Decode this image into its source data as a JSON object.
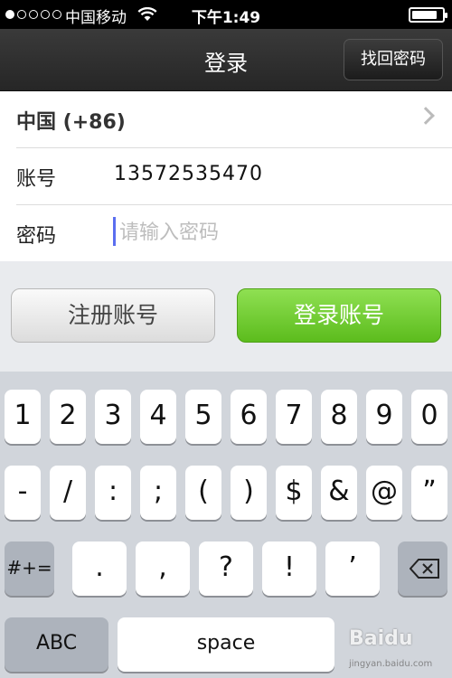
{
  "status_bar": {
    "carrier": "中国移动",
    "time": "下午1:49",
    "signal_bars": 1,
    "signal_total": 5,
    "battery_level": 0.85
  },
  "nav": {
    "title": "登录",
    "find_password": "找回密码"
  },
  "form": {
    "country": "中国 (+86)",
    "account_label": "账号",
    "account_value": "13572535470",
    "password_label": "密码",
    "password_placeholder": "请输入密码"
  },
  "actions": {
    "register": "注册账号",
    "login": "登录账号"
  },
  "keyboard": {
    "row1": [
      "1",
      "2",
      "3",
      "4",
      "5",
      "6",
      "7",
      "8",
      "9",
      "0"
    ],
    "row2": [
      "-",
      "/",
      ":",
      ";",
      "(",
      ")",
      "$",
      "&",
      "@",
      "”"
    ],
    "row3_left": "#+=",
    "row3": [
      ".",
      ",",
      "?",
      "!",
      "’"
    ],
    "row3_icon": "backspace-icon",
    "abc": "ABC",
    "space": "space"
  },
  "watermark": {
    "brand": "Baidu",
    "site": "jingyan.baidu.com"
  },
  "colors": {
    "login_green": "#6bc92b",
    "nav_dark": "#2b2b2b",
    "caret": "#5b6ef0"
  }
}
